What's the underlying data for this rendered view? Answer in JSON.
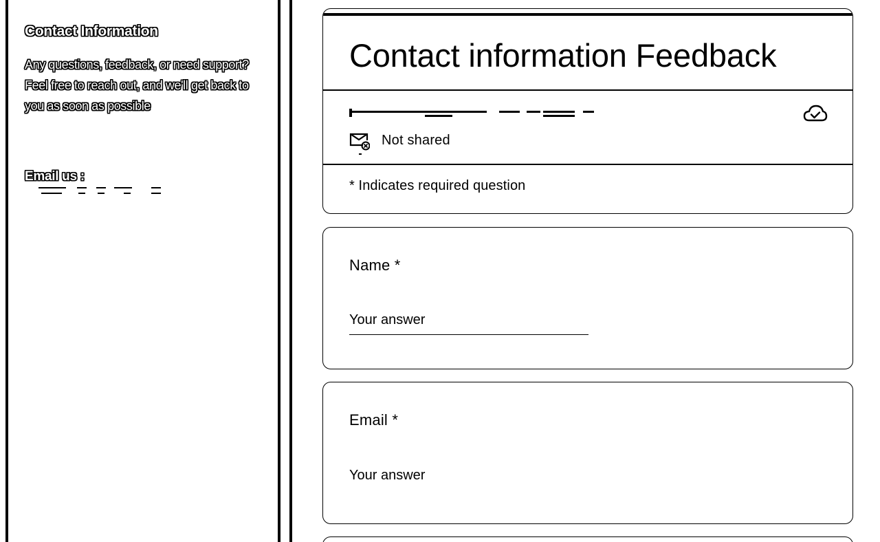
{
  "sidebar": {
    "title": "Contact Information",
    "description": "Any questions, feedback, or need support? Feel free to reach out, and we'll get back to you as soon as possible",
    "email_label": "Email us :",
    "email_icon": "redacted-text"
  },
  "form": {
    "title": "Contact information Feedback",
    "account_icon": "redacted-text",
    "save_status_icon": "cloud-check-icon",
    "share_status": "Not shared",
    "share_icon": "mail-off-icon",
    "required_note": "* Indicates required question",
    "questions": [
      {
        "label": "Name *",
        "placeholder": "Your answer"
      },
      {
        "label": "Email *",
        "placeholder": "Your answer"
      }
    ]
  },
  "colors": {
    "foreground": "#000000",
    "background": "#ffffff"
  }
}
